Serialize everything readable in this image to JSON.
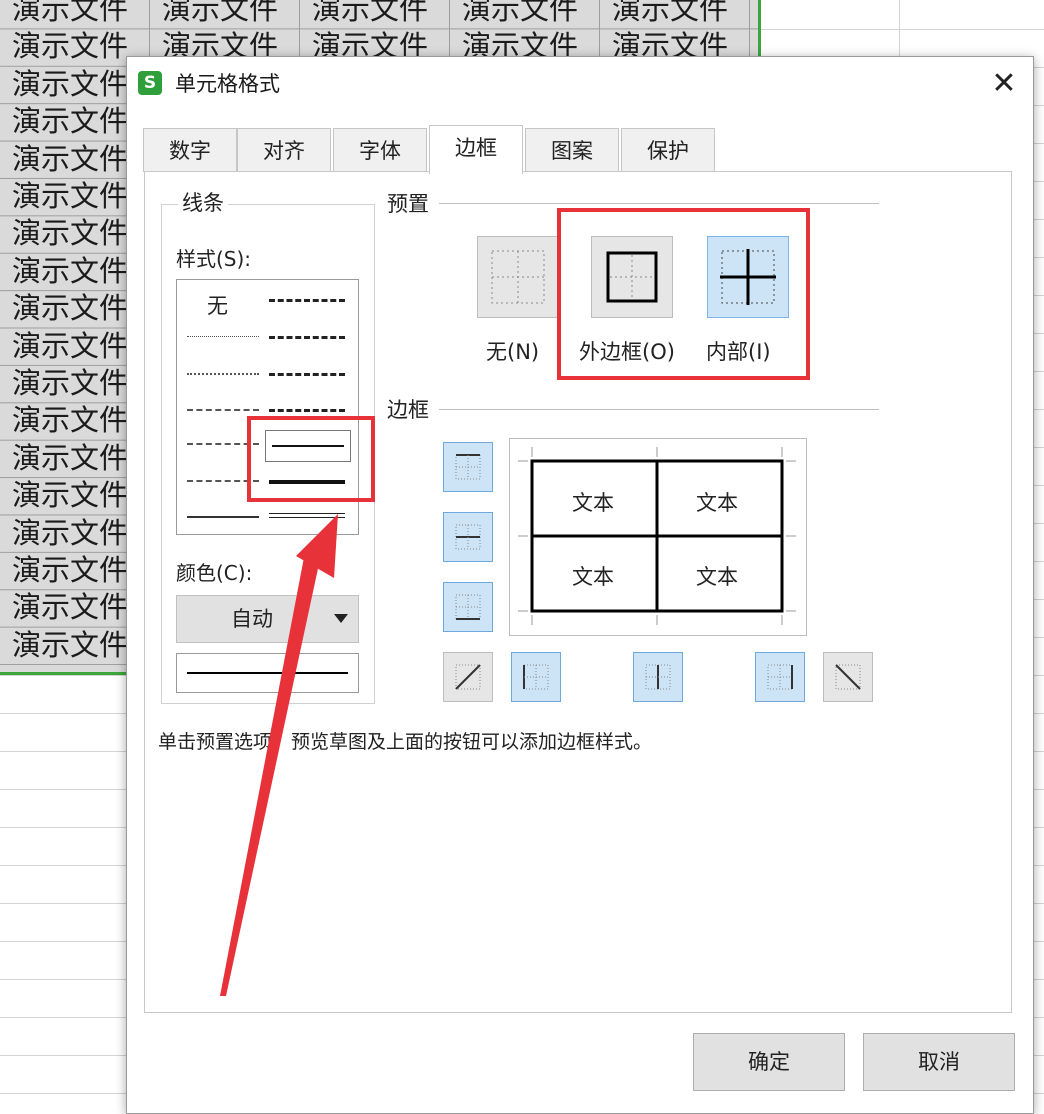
{
  "sheet": {
    "cell_text": "演示文件",
    "accent": "#3ca63c"
  },
  "dialog": {
    "title": "单元格格式",
    "app_icon": "S",
    "close_icon": "close-icon",
    "tabs": [
      {
        "label": "数字"
      },
      {
        "label": "对齐"
      },
      {
        "label": "字体"
      },
      {
        "label": "边框",
        "active": true
      },
      {
        "label": "图案"
      },
      {
        "label": "保护"
      }
    ],
    "line": {
      "group_title": "线条",
      "style_label": "样式(S):",
      "style_none": "无",
      "color_label": "颜色(C):",
      "color_value": "自动"
    },
    "preset": {
      "title": "预置",
      "none_label": "无(N)",
      "outline_label": "外边框(O)",
      "inside_label": "内部(I)"
    },
    "border": {
      "title": "边框",
      "preview_text": "文本"
    },
    "hint": "单击预置选项、预览草图及上面的按钮可以添加边框样式。",
    "ok_label": "确定",
    "cancel_label": "取消"
  },
  "annotation_color": "#e8323a"
}
